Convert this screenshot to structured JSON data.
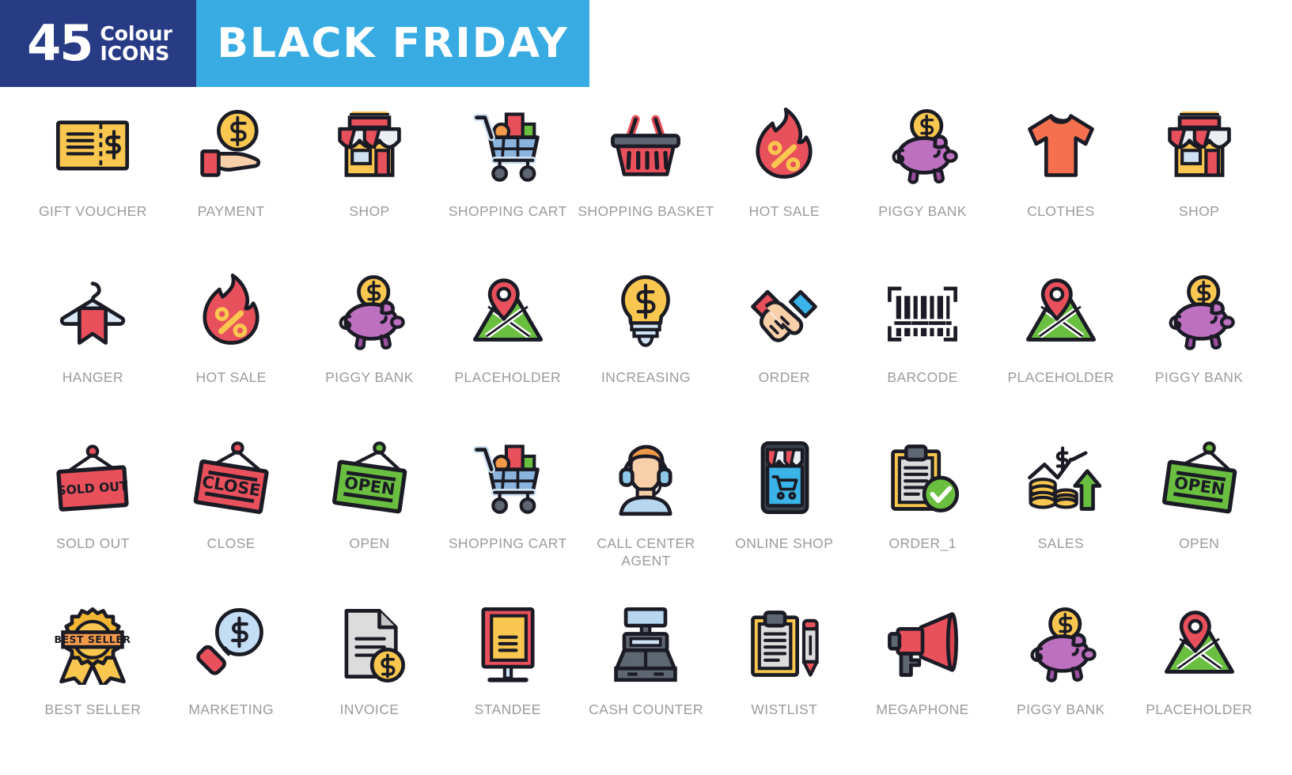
{
  "header": {
    "count": "45",
    "colour_label": "Colour",
    "icons_label": "ICONS",
    "title": "BLACK FRIDAY",
    "left_bg": "#283c86",
    "right_bg": "#38ace2",
    "text_color": "#ffffff"
  },
  "palette": {
    "outline": "#1b1b25",
    "yellow": "#f9c74f",
    "yellow_deep": "#f2b632",
    "orange": "#f2994a",
    "orange_deep": "#ee8b2d",
    "red": "#e8505b",
    "red_deep": "#d9434e",
    "coral": "#f4704f",
    "green": "#6abf40",
    "green_leaf": "#76bc43",
    "purple": "#bd6fc0",
    "purple_deep": "#9b4fa0",
    "blue": "#39b3e8",
    "blue_light": "#a8c9e8",
    "blue_pale": "#cfe2f3",
    "grey": "#d8d8d8",
    "grey_dark": "#5e6672",
    "grey_darker": "#3a4149",
    "skin": "#f7cfa8",
    "white": "#ffffff",
    "caption": "#9b9b9b",
    "sky": "#b7d7f0"
  },
  "caption_color": "#9b9b9b",
  "icons": [
    {
      "label": "GIFT VOUCHER",
      "name": "gift-voucher"
    },
    {
      "label": "PAYMENT",
      "name": "payment"
    },
    {
      "label": "SHOP",
      "name": "shop"
    },
    {
      "label": "SHOPPING CART",
      "name": "shopping-cart"
    },
    {
      "label": "SHOPPING BASKET",
      "name": "shopping-basket"
    },
    {
      "label": "HOT SALE",
      "name": "hot-sale"
    },
    {
      "label": "PIGGY BANK",
      "name": "piggy-bank"
    },
    {
      "label": "CLOTHES",
      "name": "clothes"
    },
    {
      "label": "SHOP",
      "name": "shop"
    },
    {
      "label": "HANGER",
      "name": "hanger"
    },
    {
      "label": "HOT SALE",
      "name": "hot-sale"
    },
    {
      "label": "PIGGY BANK",
      "name": "piggy-bank"
    },
    {
      "label": "PLACEHOLDER",
      "name": "placeholder"
    },
    {
      "label": "INCREASING",
      "name": "increasing"
    },
    {
      "label": "ORDER",
      "name": "order"
    },
    {
      "label": "BARCODE",
      "name": "barcode"
    },
    {
      "label": "PLACEHOLDER",
      "name": "placeholder"
    },
    {
      "label": "PIGGY BANK",
      "name": "piggy-bank"
    },
    {
      "label": "SOLD OUT",
      "name": "sold-out"
    },
    {
      "label": "CLOSE",
      "name": "close"
    },
    {
      "label": "OPEN",
      "name": "open"
    },
    {
      "label": "SHOPPING CART",
      "name": "shopping-cart"
    },
    {
      "label": "CALL CENTER AGENT",
      "name": "call-center-agent"
    },
    {
      "label": "ONLINE SHOP",
      "name": "online-shop"
    },
    {
      "label": "ORDER_1",
      "name": "order-1"
    },
    {
      "label": "SALES",
      "name": "sales"
    },
    {
      "label": "OPEN",
      "name": "open"
    },
    {
      "label": "BEST SELLER",
      "name": "best-seller"
    },
    {
      "label": "MARKETING",
      "name": "marketing"
    },
    {
      "label": "INVOICE",
      "name": "invoice"
    },
    {
      "label": "STANDEE",
      "name": "standee"
    },
    {
      "label": "CASH COUNTER",
      "name": "cash-counter"
    },
    {
      "label": "WISTLIST",
      "name": "wistlist"
    },
    {
      "label": "MEGAPHONE",
      "name": "megaphone"
    },
    {
      "label": "PIGGY BANK",
      "name": "piggy-bank"
    },
    {
      "label": "PLACEHOLDER",
      "name": "placeholder"
    }
  ],
  "sign_texts": {
    "sold_out": "SOLD OUT",
    "close": "CLOSE",
    "open": "OPEN",
    "best_seller": "BEST SELLER"
  }
}
